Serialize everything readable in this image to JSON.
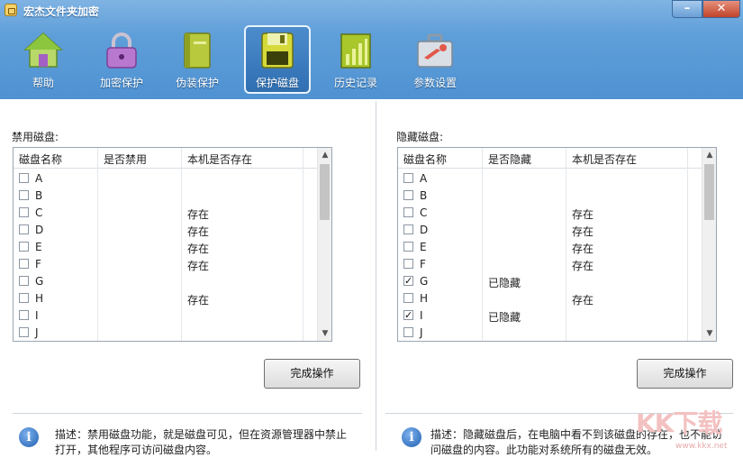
{
  "app": {
    "title": "宏杰文件夹加密",
    "minimize": "–",
    "close": "✕"
  },
  "toolbar": [
    {
      "label": "帮助",
      "icon": "house-icon"
    },
    {
      "label": "加密保护",
      "icon": "padlock-icon"
    },
    {
      "label": "伪装保护",
      "icon": "notebook-icon"
    },
    {
      "label": "保护磁盘",
      "icon": "floppy-disk-icon",
      "active": true
    },
    {
      "label": "历史记录",
      "icon": "bar-chart-icon"
    },
    {
      "label": "参数设置",
      "icon": "toolbox-icon"
    }
  ],
  "left": {
    "label": "禁用磁盘:",
    "columns": [
      "磁盘名称",
      "是否禁用",
      "本机是否存在"
    ],
    "rows": [
      {
        "name": "A",
        "checked": false,
        "col2": "",
        "col3": ""
      },
      {
        "name": "B",
        "checked": false,
        "col2": "",
        "col3": ""
      },
      {
        "name": "C",
        "checked": false,
        "col2": "",
        "col3": "存在"
      },
      {
        "name": "D",
        "checked": false,
        "col2": "",
        "col3": "存在"
      },
      {
        "name": "E",
        "checked": false,
        "col2": "",
        "col3": "存在"
      },
      {
        "name": "F",
        "checked": false,
        "col2": "",
        "col3": "存在"
      },
      {
        "name": "G",
        "checked": false,
        "col2": "",
        "col3": ""
      },
      {
        "name": "H",
        "checked": false,
        "col2": "",
        "col3": "存在"
      },
      {
        "name": "I",
        "checked": false,
        "col2": "",
        "col3": ""
      },
      {
        "name": "J",
        "checked": false,
        "col2": "",
        "col3": ""
      }
    ],
    "button": "完成操作",
    "description": "描述：禁用磁盘功能，就是磁盘可见，但在资源管理器中禁止打开，其他程序可访问磁盘内容。"
  },
  "right": {
    "label": "隐藏磁盘:",
    "columns": [
      "磁盘名称",
      "是否隐藏",
      "本机是否存在"
    ],
    "rows": [
      {
        "name": "A",
        "checked": false,
        "col2": "",
        "col3": ""
      },
      {
        "name": "B",
        "checked": false,
        "col2": "",
        "col3": ""
      },
      {
        "name": "C",
        "checked": false,
        "col2": "",
        "col3": "存在"
      },
      {
        "name": "D",
        "checked": false,
        "col2": "",
        "col3": "存在"
      },
      {
        "name": "E",
        "checked": false,
        "col2": "",
        "col3": "存在"
      },
      {
        "name": "F",
        "checked": false,
        "col2": "",
        "col3": "存在"
      },
      {
        "name": "G",
        "checked": true,
        "col2": "已隐藏",
        "col3": ""
      },
      {
        "name": "H",
        "checked": false,
        "col2": "",
        "col3": "存在"
      },
      {
        "name": "I",
        "checked": true,
        "col2": "已隐藏",
        "col3": ""
      },
      {
        "name": "J",
        "checked": false,
        "col2": "",
        "col3": ""
      }
    ],
    "button": "完成操作",
    "description": "描述：隐藏磁盘后，在电脑中看不到该磁盘的存在，也不能访问磁盘的内容。此功能对系统所有的磁盘无效。"
  },
  "watermark": {
    "text": "KK下载",
    "sub": "www.kkx.net"
  },
  "colors": {
    "header": "#5f9fd9",
    "active_tab": "#2f6fb2",
    "close": "#c0432a"
  }
}
